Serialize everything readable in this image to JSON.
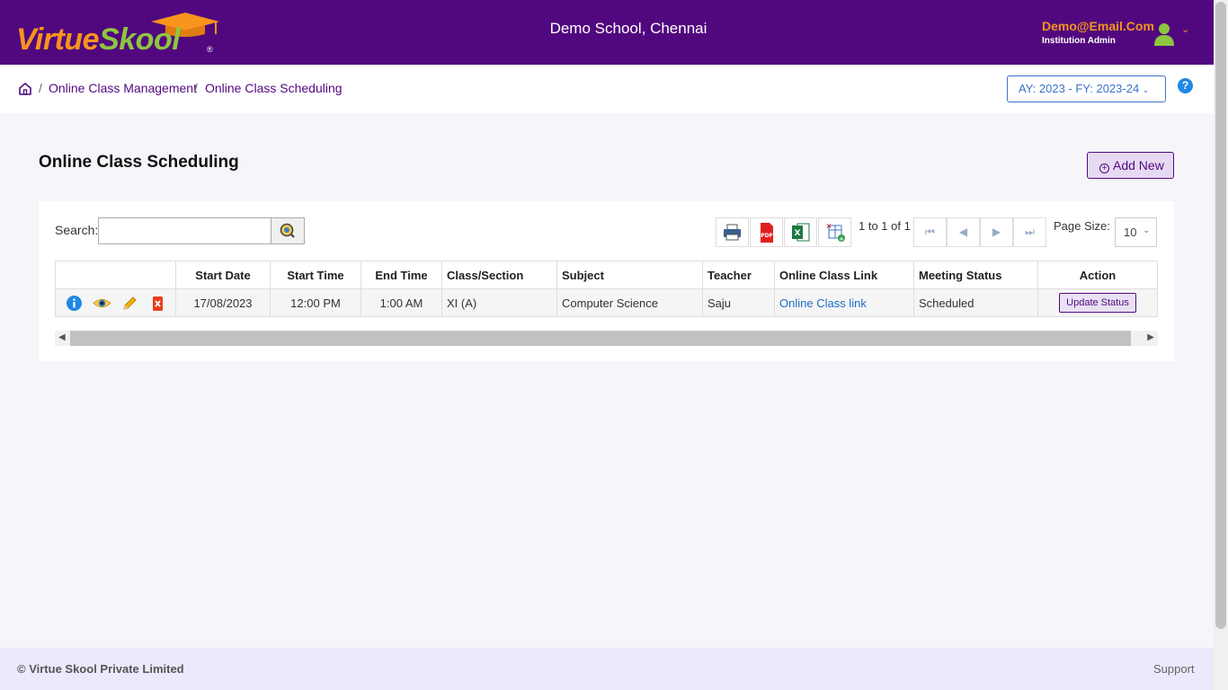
{
  "header": {
    "logo_part1": "Virtue",
    "logo_part2": "Skool",
    "logo_reg": "®",
    "school": "Demo School, Chennai",
    "user_email": "Demo@Email.Com",
    "user_role": "Institution Admin"
  },
  "breadcrumb": {
    "sep": "/",
    "items": [
      "Online Class Management",
      "Online Class Scheduling"
    ]
  },
  "ay_select": {
    "value": "AY: 2023 - FY: 2023-24"
  },
  "help": "?",
  "page": {
    "title": "Online Class Scheduling",
    "add_new": "Add New"
  },
  "toolbar": {
    "search_label": "Search:",
    "search_value": "",
    "pager_text": "1 to 1 of 1",
    "page_size_label": "Page Size:",
    "page_size": "10"
  },
  "table": {
    "columns": [
      "",
      "Start Date",
      "Start Time",
      "End Time",
      "Class/Section",
      "Subject",
      "Teacher",
      "Online Class Link",
      "Meeting Status",
      "Action"
    ],
    "rows": [
      {
        "start_date": "17/08/2023",
        "start_time": "12:00 PM",
        "end_time": "1:00 AM",
        "class_section": "XI (A)",
        "subject": "Computer Science",
        "teacher": "Saju",
        "link": "Online Class link",
        "status": "Scheduled",
        "action": "Update Status"
      }
    ]
  },
  "footer": {
    "copyright": "© Virtue Skool Private Limited",
    "support": "Support"
  },
  "colors": {
    "brand": "#51087e",
    "orange": "#f7941d",
    "green": "#8dc63f",
    "link": "#1e70c2"
  }
}
